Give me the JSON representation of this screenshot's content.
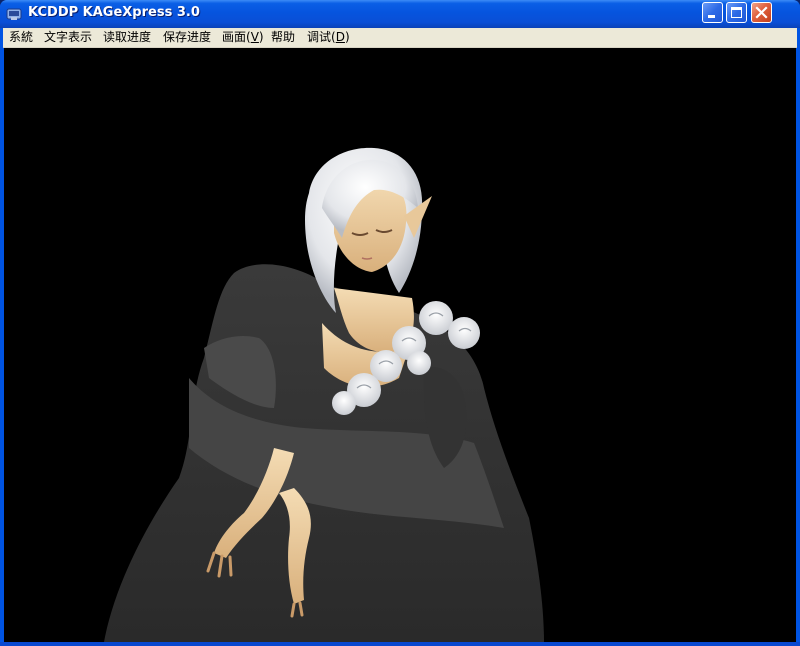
{
  "window": {
    "title": "KCDDP KAGeXpress 3.0"
  },
  "menu": {
    "items": [
      {
        "label": "系統"
      },
      {
        "label": "文字表示"
      },
      {
        "label": "读取进度"
      },
      {
        "label": "保存进度"
      },
      {
        "label": "画面",
        "mnemonic": "V"
      },
      {
        "label": "帮助"
      },
      {
        "label": "调试",
        "mnemonic": "D"
      }
    ]
  },
  "colors": {
    "titlebar": "#0654de",
    "menubar": "#ece9d8",
    "stage": "#000000",
    "close_button": "#e0603d"
  },
  "icons": {
    "app": "kag-app-icon",
    "minimize": "minimize-icon",
    "maximize": "maximize-icon",
    "close": "close-icon"
  },
  "scene": {
    "background": "black",
    "character": "white-haired elf woman in black dress with white roses on shoulder"
  }
}
